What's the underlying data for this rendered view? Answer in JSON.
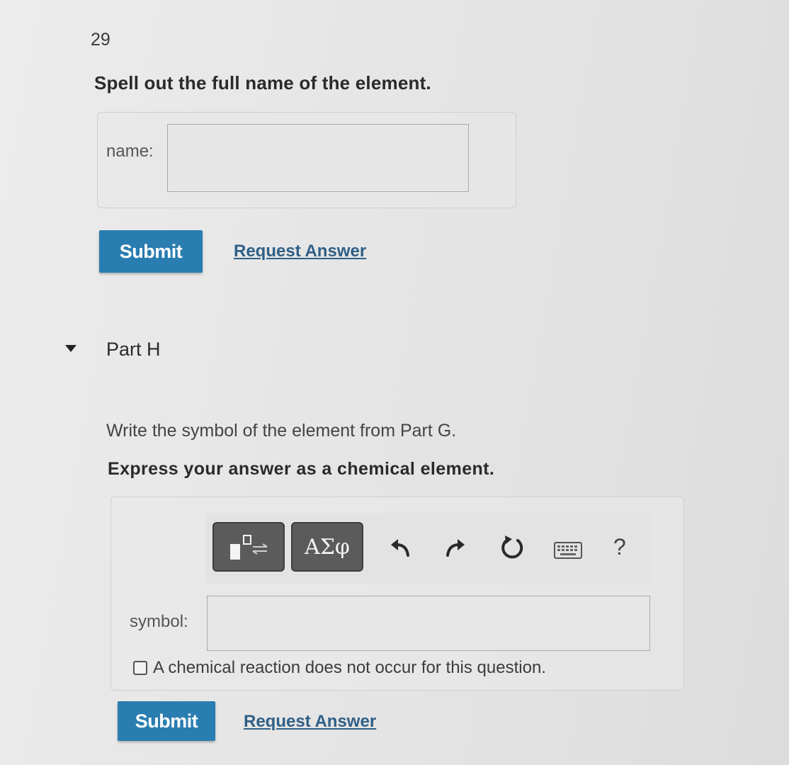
{
  "question_number": "29",
  "part_g": {
    "prompt": "Spell out the full name of the element.",
    "name_label": "name",
    "name_value": "",
    "submit_label": "Submit",
    "request_answer_label": "Request Answer"
  },
  "part_h": {
    "title": "Part H",
    "instruction": "Write the symbol of the element from Part G.",
    "express": "Express your answer as a chemical element.",
    "toolbar": {
      "greek_label": "ΑΣφ",
      "help_label": "?",
      "icons": [
        "templates-icon",
        "undo-icon",
        "redo-icon",
        "reset-icon",
        "keyboard-icon"
      ]
    },
    "symbol_label": "symbol",
    "symbol_value": "",
    "no_reaction_label": "A chemical reaction does not occur for this question.",
    "no_reaction_checked": false,
    "submit_label": "Submit",
    "request_answer_label": "Request Answer"
  },
  "colors": {
    "submit_bg": "#2a7db0",
    "link": "#2f5f86",
    "toolbar_button": "#5b5b5b"
  }
}
